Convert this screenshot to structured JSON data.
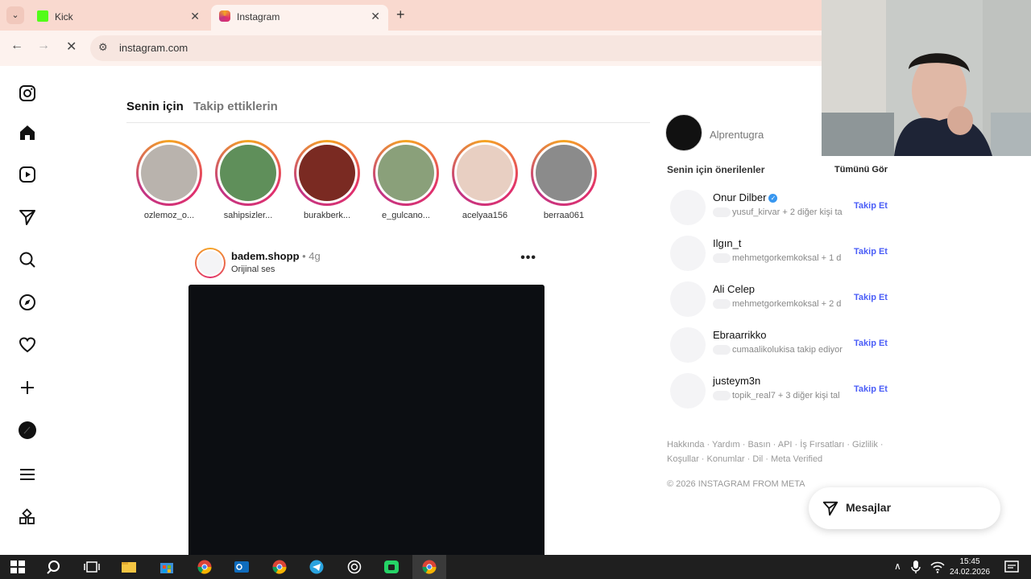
{
  "browser": {
    "tabs": [
      {
        "title": "Kick",
        "active": false,
        "favicon_color": "#53fc18"
      },
      {
        "title": "Instagram",
        "active": true,
        "favicon_color": "#e1306c"
      }
    ],
    "url": "instagram.com"
  },
  "feed_tabs": {
    "for_you": "Senin için",
    "following": "Takip ettiklerin"
  },
  "stories": [
    {
      "name": "ozlemoz_o...",
      "color": "#b9b3ad"
    },
    {
      "name": "sahipsizler...",
      "color": "#5f8f5a"
    },
    {
      "name": "burakberk...",
      "color": "#7a2a22"
    },
    {
      "name": "e_gulcano...",
      "color": "#8aa07a"
    },
    {
      "name": "acelyaa156",
      "color": "#e8cfc2"
    },
    {
      "name": "berraa061",
      "color": "#8b8b8b"
    }
  ],
  "post": {
    "username": "badem.shopp",
    "time": " • 4g",
    "audio": "Orijinal ses",
    "more": "•••"
  },
  "account": {
    "display_name": "Alprentugra"
  },
  "suggestions": {
    "title": "Senin için önerilenler",
    "see_all": "Tümünü Gör",
    "items": [
      {
        "name": "Onur Dilber",
        "verified": true,
        "sub": "yusuf_kirvar + 2 diğer kişi ta",
        "follow": "Takip Et"
      },
      {
        "name": "Ilgın_t",
        "verified": false,
        "sub": "mehmetgorkemkoksal + 1 d",
        "follow": "Takip Et"
      },
      {
        "name": "Ali Celep",
        "verified": false,
        "sub": "mehmetgorkemkoksal + 2 d",
        "follow": "Takip Et"
      },
      {
        "name": "Ebraarrikko",
        "verified": false,
        "sub": "cumaalikolukisa takip ediyor",
        "follow": "Takip Et"
      },
      {
        "name": "justeym3n",
        "verified": false,
        "sub": "topik_real7 + 3 diğer kişi tal",
        "follow": "Takip Et"
      }
    ]
  },
  "footer": {
    "links_line1": "Hakkında · Yardım · Basın · API · İş Fırsatları · Gizlilik ·",
    "links_line2": "Koşullar · Konumlar · Dil · Meta Verified",
    "copyright": "© 2026 INSTAGRAM FROM META"
  },
  "messages": {
    "label": "Mesajlar"
  },
  "taskbar": {
    "time": "15:45",
    "date": "24.02.2026"
  }
}
